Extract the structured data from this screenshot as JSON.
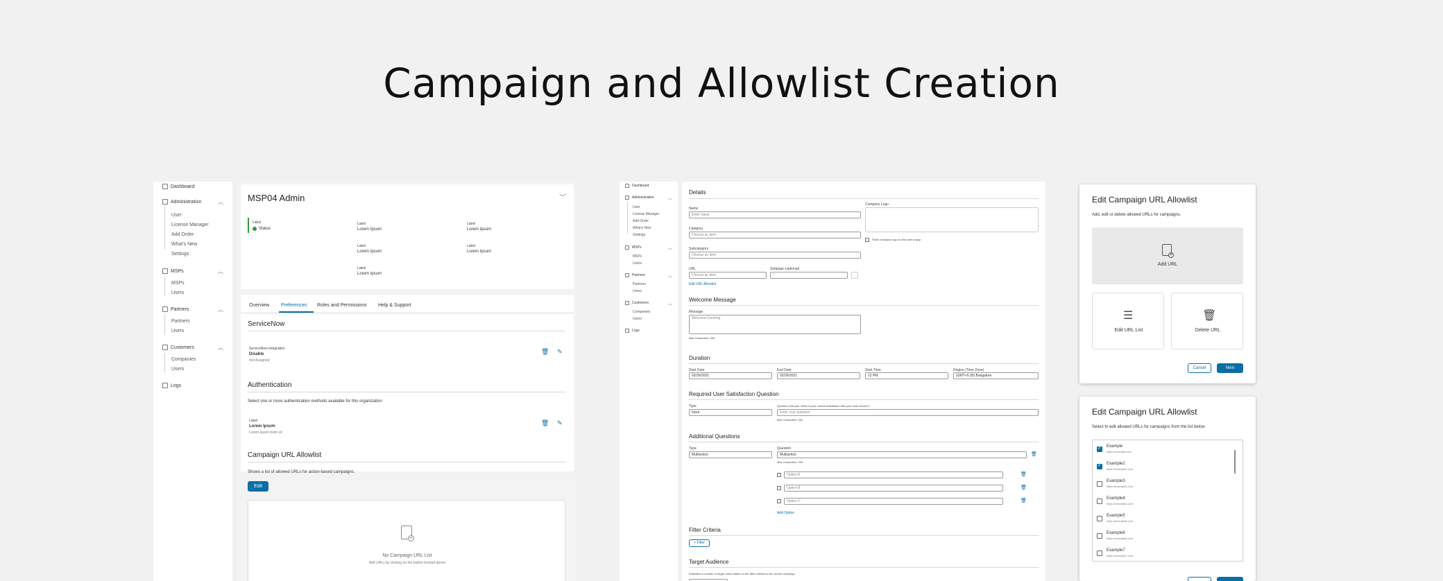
{
  "page_title": "Campaign and Allowlist Creation",
  "screen1": {
    "nav": {
      "dashboard": "Dashboard",
      "administration": "Administration",
      "admin_items": [
        "User",
        "License Manager",
        "Add Order",
        "What's New",
        "Settings"
      ],
      "msps": "MSPs",
      "msps_items": [
        "MSPs",
        "Users"
      ],
      "partners": "Partners",
      "partners_items": [
        "Partners",
        "Users"
      ],
      "customers": "Customers",
      "customers_items": [
        "Companies",
        "Users"
      ],
      "logs": "Logs"
    },
    "header_title": "MSP04 Admin",
    "status_label": "Label",
    "status_value": "Status",
    "fields": [
      {
        "label": "Label",
        "value": "Lorem Ipsum"
      },
      {
        "label": "Label",
        "value": "Lorem Ipsum"
      },
      {
        "label": "Label",
        "value": "Lorem Ipsum"
      },
      {
        "label": "Label",
        "value": "Lorem Ipsum"
      },
      {
        "label": "Label",
        "value": "Lorem Ipsum"
      }
    ],
    "tabs": [
      "Overview",
      "Preferences",
      "Roles and Permissions",
      "Help & Support"
    ],
    "servicenow": {
      "heading": "ServiceNow",
      "label": "ServiceNow Integration",
      "value": "Disable",
      "sub": "Not Assigned"
    },
    "authentication": {
      "heading": "Authentication",
      "desc": "Select one or more authentication methods available for this organization",
      "label": "Label",
      "value": "Lorem Ipsum",
      "sub": "Lorem ipsum dolor sit"
    },
    "allowlist": {
      "heading": "Campaign URL Allowlist",
      "desc": "Shows a list of allowed URLs for action-based campaigns.",
      "edit_button": "Edit",
      "empty_title": "No Campaign URL List",
      "empty_sub": "Add URLs by clicking on the button located above"
    }
  },
  "screen2": {
    "nav": {
      "dashboard": "Dashboard",
      "administration": "Administration",
      "admin_items": [
        "User",
        "License Manager",
        "Add Order",
        "What's New",
        "Settings"
      ],
      "msps": "MSPs",
      "msps_items": [
        "MSPs",
        "Users"
      ],
      "partners": "Partners",
      "partners_items": [
        "Partners",
        "Users"
      ],
      "customers": "Customers",
      "customers_items": [
        "Companies",
        "Users"
      ],
      "logs": "Logs"
    },
    "details": {
      "heading": "Details",
      "name_label": "Name",
      "name_placeholder": "Enter name",
      "category_label": "Category",
      "category_placeholder": "Choose an item",
      "subcategory_label": "Subcategory",
      "subcategory_placeholder": "Choose an item",
      "url_label": "URL",
      "url_placeholder": "Choose an item",
      "subpage_label": "Subpage (optional)",
      "subpage_value": "/",
      "edit_url_link": "Edit URL Allowlist",
      "company_logo_label": "Company Logo",
      "show_logo_label": "Show company logo on end user popup"
    },
    "welcome": {
      "heading": "Welcome Message",
      "message_label": "Message",
      "message_placeholder": "Welcome Greeting",
      "max_chars": "Max Characters: 250"
    },
    "duration": {
      "heading": "Duration",
      "start_date_label": "Start Date",
      "start_date": "02/26/2021",
      "end_date_label": "End Date",
      "end_date": "02/26/2021",
      "start_time_label": "Start Time",
      "start_time": "12 PM",
      "region_label": "Region (Time Zone)",
      "region": "(GMT+5:30) Bangalore"
    },
    "satisfaction": {
      "heading": "Required User Satisfaction Question",
      "type_label": "Type",
      "type_value": "Input",
      "question_label": "Question (Sample: What is your overall satisfaction with your work device?)",
      "question_placeholder": "Enter your question",
      "max_chars": "Max Characters: 250"
    },
    "additional": {
      "heading": "Additional Questions",
      "type_label": "Type",
      "type_value": "Multiselect",
      "question_label": "Question",
      "question_value": "Multiselect",
      "max_chars": "Max Characters: 250",
      "options": [
        "Option A",
        "Option B",
        "Option C"
      ],
      "add_option": "Add Option"
    },
    "filter": {
      "heading": "Filter Criteria",
      "button": "+ Filter"
    },
    "target": {
      "heading": "Target Audience",
      "desc": "Estimates a number of target users based on the filter criteria for the current campaign"
    }
  },
  "screen3": {
    "title": "Edit Campaign URL Allowlist",
    "desc": "Add, edit or delete allowed URLs for campaigns.",
    "add_url": "Add URL",
    "edit_url_list": "Edit URL List",
    "delete_url": "Delete URL",
    "cancel": "Cancel",
    "next": "Next"
  },
  "screen4": {
    "title": "Edit Campaign URL Allowlist",
    "desc": "Select to edit allowed URLs for campaigns from the list below",
    "items": [
      {
        "name": "Example",
        "url": "https://example.com",
        "checked": true
      },
      {
        "name": "Example2",
        "url": "https://example2.com",
        "checked": true
      },
      {
        "name": "Example3",
        "url": "https://example3.com",
        "checked": false
      },
      {
        "name": "Example4",
        "url": "https://example4.com",
        "checked": false
      },
      {
        "name": "Example5",
        "url": "https://example5.com",
        "checked": false
      },
      {
        "name": "Example6",
        "url": "https://example6.com",
        "checked": false
      },
      {
        "name": "Example7",
        "url": "https://example7.com",
        "checked": false
      }
    ]
  },
  "colors": {
    "accent": "#0b6ea6",
    "status_green": "#2e9a3d",
    "background": "#f1f1f1"
  }
}
